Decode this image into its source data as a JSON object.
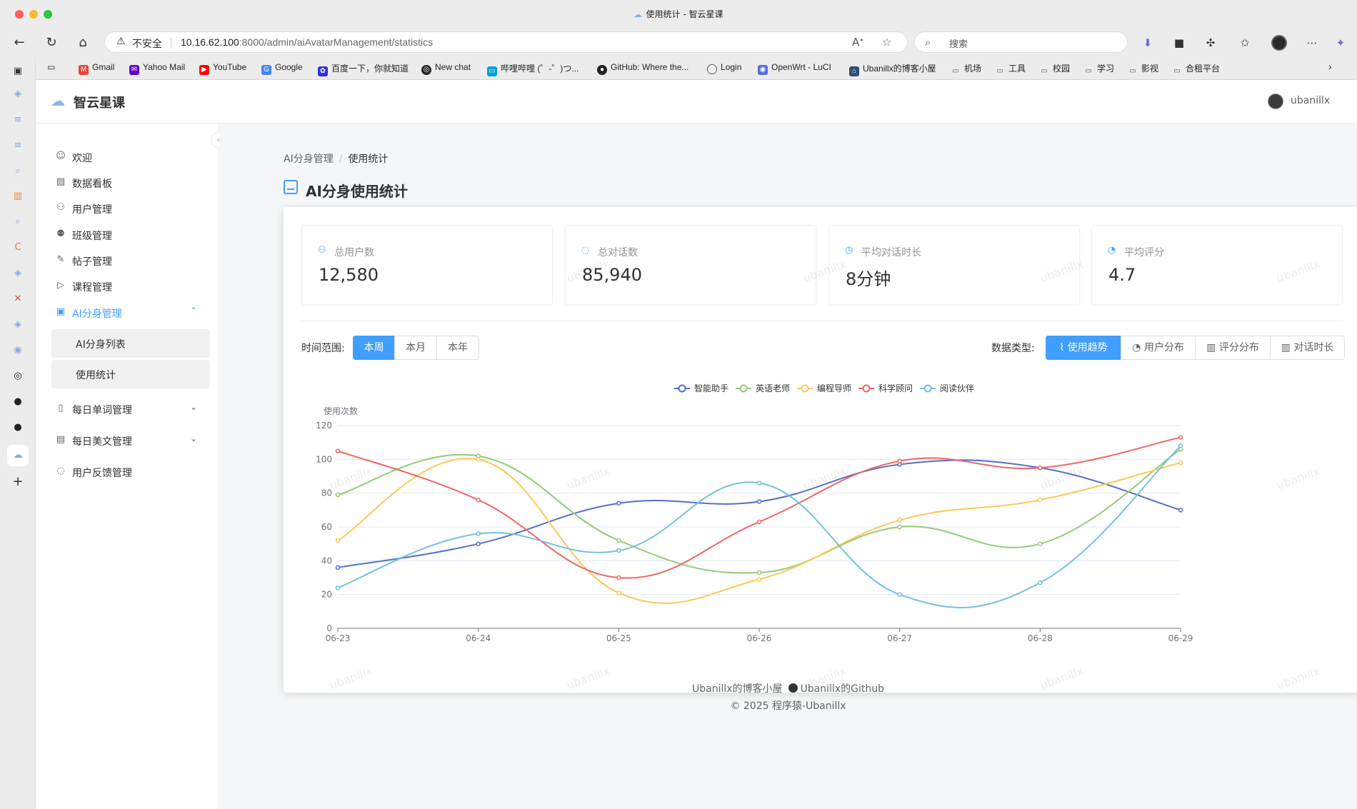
{
  "browser": {
    "window_title": "使用统计 - 智云星课",
    "insecure_label": "不安全",
    "url_host": "10.16.62.100",
    "url_rest": ":8000/admin/aiAvatarManagement/statistics",
    "search_placeholder": "搜索",
    "bookmarks": [
      {
        "label": "Gmail",
        "icon": "gmail-icon",
        "color": "#ea4335"
      },
      {
        "label": "Yahoo Mail",
        "icon": "yahoo-icon",
        "color": "#6001d2"
      },
      {
        "label": "YouTube",
        "icon": "youtube-icon",
        "color": "#ff0000"
      },
      {
        "label": "Google",
        "icon": "google-icon",
        "color": "#4285f4"
      },
      {
        "label": "百度一下，你就知道",
        "icon": "baidu-icon",
        "color": "#2932e1"
      },
      {
        "label": "New chat",
        "icon": "chatgpt-icon",
        "color": "#222222"
      },
      {
        "label": "哔哩哔哩 (゜-゜)つ...",
        "icon": "bilibili-icon",
        "color": "#00a1d6"
      },
      {
        "label": "GitHub: Where the...",
        "icon": "github-icon",
        "color": "#222222"
      },
      {
        "label": "Login",
        "icon": "globe-icon",
        "color": "#555555"
      },
      {
        "label": "OpenWrt - LuCI",
        "icon": "openwrt-icon",
        "color": "#5470d6"
      },
      {
        "label": "Ubanillx的博客小屋",
        "icon": "blog-icon",
        "color": "#2f4f6f"
      },
      {
        "label": "机场",
        "icon": "folder-icon",
        "color": "#555555"
      },
      {
        "label": "工具",
        "icon": "folder-icon",
        "color": "#555555"
      },
      {
        "label": "校园",
        "icon": "folder-icon",
        "color": "#555555"
      },
      {
        "label": "学习",
        "icon": "folder-icon",
        "color": "#555555"
      },
      {
        "label": "影视",
        "icon": "folder-icon",
        "color": "#555555"
      },
      {
        "label": "合租平台",
        "icon": "folder-icon",
        "color": "#555555"
      }
    ]
  },
  "app": {
    "name": "智云星课",
    "user": "ubanillx",
    "menu": [
      {
        "label": "欢迎",
        "icon": "smile-icon"
      },
      {
        "label": "数据看板",
        "icon": "chart-icon"
      },
      {
        "label": "用户管理",
        "icon": "user-icon"
      },
      {
        "label": "班级管理",
        "icon": "team-icon"
      },
      {
        "label": "帖子管理",
        "icon": "edit-icon"
      },
      {
        "label": "课程管理",
        "icon": "play-icon"
      },
      {
        "label": "AI分身管理",
        "icon": "robot-icon"
      },
      {
        "label": "每日单词管理",
        "icon": "book-icon"
      },
      {
        "label": "每日美文管理",
        "icon": "file-icon"
      },
      {
        "label": "用户反馈管理",
        "icon": "message-icon"
      }
    ],
    "submenu": [
      {
        "label": "AI分身列表"
      },
      {
        "label": "使用统计"
      }
    ]
  },
  "page": {
    "breadcrumb": [
      "AI分身管理",
      "使用统计"
    ],
    "title": "AI分身使用统计",
    "stats": [
      {
        "label": "总用户数",
        "value": "12,580",
        "icon": "user-icon"
      },
      {
        "label": "总对话数",
        "value": "85,940",
        "icon": "chat-icon"
      },
      {
        "label": "平均对话时长",
        "value": "8分钟",
        "icon": "clock-icon"
      },
      {
        "label": "平均评分",
        "value": "4.7",
        "icon": "pie-icon"
      }
    ],
    "range_label": "时间范围:",
    "ranges": [
      "本周",
      "本月",
      "本年"
    ],
    "active_range": "本周",
    "type_label": "数据类型:",
    "types": [
      "使用趋势",
      "用户分布",
      "评分分布",
      "对话时长"
    ],
    "active_type": "使用趋势",
    "watermark": "ubanillx"
  },
  "chart_data": {
    "type": "line",
    "ylabel": "使用次数",
    "ylim": [
      0,
      120
    ],
    "yticks": [
      0,
      20,
      40,
      60,
      80,
      100,
      120
    ],
    "x": [
      "06-23",
      "06-24",
      "06-25",
      "06-26",
      "06-27",
      "06-28",
      "06-29"
    ],
    "series": [
      {
        "name": "智能助手",
        "color": "#5470c6",
        "values": [
          36,
          50,
          74,
          75,
          97,
          95,
          70
        ]
      },
      {
        "name": "英语老师",
        "color": "#91cc75",
        "values": [
          79,
          102,
          52,
          33,
          60,
          50,
          106
        ]
      },
      {
        "name": "编程导师",
        "color": "#fac858",
        "values": [
          52,
          100,
          21,
          29,
          64,
          76,
          98
        ]
      },
      {
        "name": "科学顾问",
        "color": "#ee6666",
        "values": [
          105,
          76,
          30,
          63,
          99,
          95,
          113
        ]
      },
      {
        "name": "阅读伙伴",
        "color": "#73c0de",
        "values": [
          24,
          56,
          46,
          86,
          20,
          27,
          108
        ]
      }
    ],
    "grid": true,
    "legend": "top-center"
  },
  "footer": {
    "blog": "Ubanillx的博客小屋",
    "github": "Ubanillx的Github",
    "copyright": "© 2025 程序猿-Ubanillx"
  }
}
